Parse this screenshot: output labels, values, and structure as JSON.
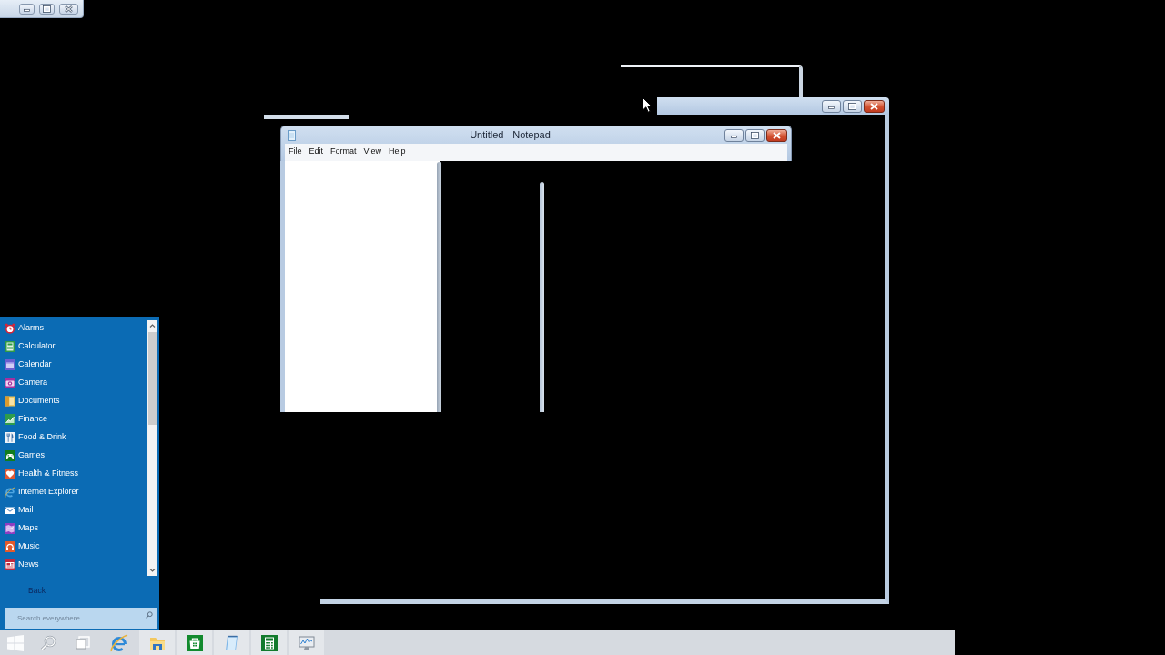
{
  "notepad": {
    "title": "Untitled - Notepad",
    "menu": [
      "File",
      "Edit",
      "Format",
      "View",
      "Help"
    ]
  },
  "start_menu": {
    "apps": [
      {
        "label": "Alarms",
        "kind": "alarm"
      },
      {
        "label": "Calculator",
        "kind": "calculator"
      },
      {
        "label": "Calendar",
        "kind": "calendar"
      },
      {
        "label": "Camera",
        "kind": "camera"
      },
      {
        "label": "Documents",
        "kind": "folder"
      },
      {
        "label": "Finance",
        "kind": "chart"
      },
      {
        "label": "Food & Drink",
        "kind": "cutlery"
      },
      {
        "label": "Games",
        "kind": "gamepad"
      },
      {
        "label": "Health & Fitness",
        "kind": "heart"
      },
      {
        "label": "Internet Explorer",
        "kind": "browser"
      },
      {
        "label": "Mail",
        "kind": "envelope"
      },
      {
        "label": "Maps",
        "kind": "map"
      },
      {
        "label": "Music",
        "kind": "headphones"
      },
      {
        "label": "News",
        "kind": "newspaper"
      }
    ],
    "back": "Back",
    "search": {
      "placeholder": "Search everywhere"
    }
  },
  "taskbar": {
    "buttons": [
      {
        "kind": "start",
        "running": false
      },
      {
        "kind": "search",
        "running": false
      },
      {
        "kind": "task-view",
        "running": false
      },
      {
        "kind": "browser",
        "running": false
      },
      {
        "kind": "folder",
        "running": true
      },
      {
        "kind": "store",
        "running": true
      },
      {
        "kind": "notepad",
        "running": true
      },
      {
        "kind": "calculator",
        "running": true
      },
      {
        "kind": "monitor",
        "running": true
      }
    ]
  }
}
